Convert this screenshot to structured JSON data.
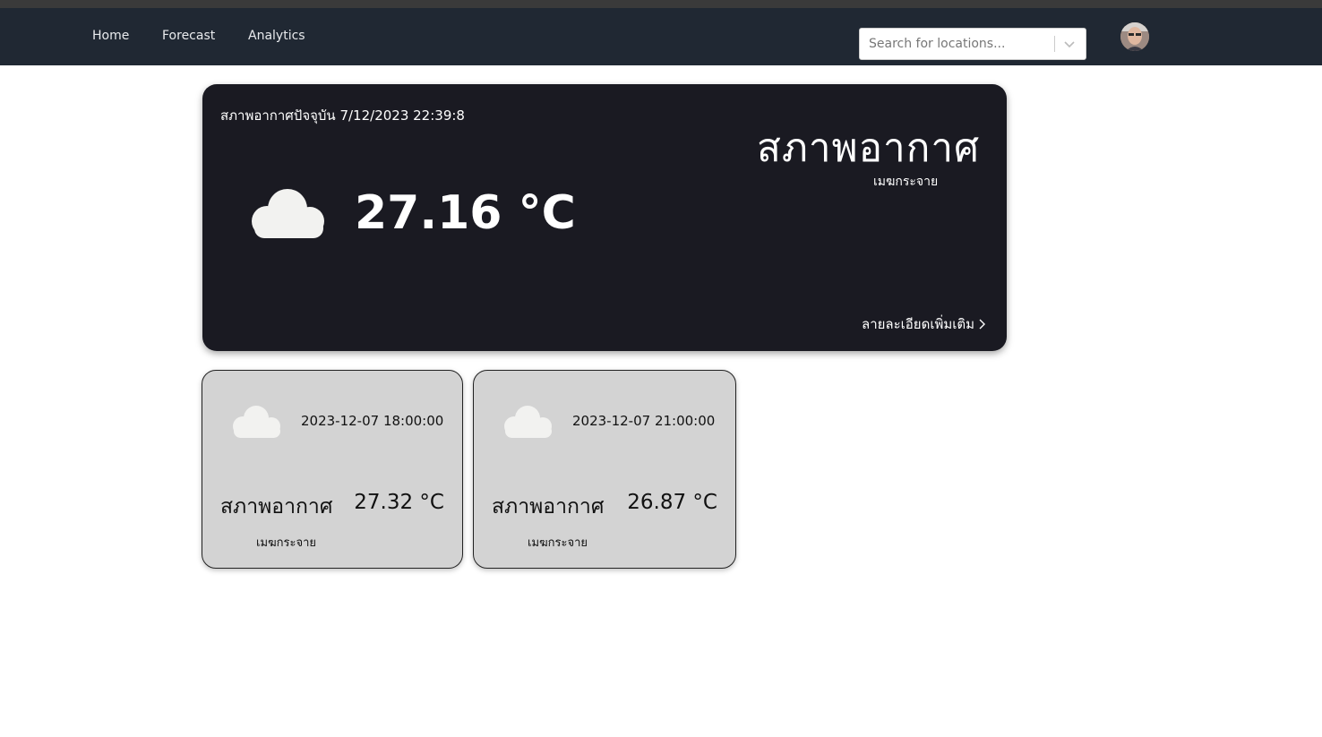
{
  "nav": {
    "links": [
      "Home",
      "Forecast",
      "Analytics"
    ],
    "search": {
      "placeholder": "Search for locations...",
      "value": ""
    },
    "search_icon": "chevron-down-icon",
    "avatar_icon": "user-avatar"
  },
  "current": {
    "datetime_label": "สภาพอากาศปัจจุบัน 7/12/2023 22:39:8",
    "title": "สภาพอากาศ",
    "description": "เมฆกระจาย",
    "temperature": "27.16 °C",
    "more_link": "ลายละเอียดเพิ่มเติม",
    "icon": "cloud-icon"
  },
  "forecast": [
    {
      "time": "2023-12-07 18:00:00",
      "title": "สภาพอากาศ",
      "temperature": "27.32 °C",
      "description": "เมฆกระจาย",
      "icon": "cloud-icon"
    },
    {
      "time": "2023-12-07 21:00:00",
      "title": "สภาพอากาศ",
      "temperature": "26.87 °C",
      "description": "เมฆกระจาย",
      "icon": "cloud-icon"
    }
  ],
  "colors": {
    "navbar": "#202833",
    "main_card": "#1a1a22",
    "forecast_card": "#d3d3d3",
    "cloud": "#f2f2f0"
  }
}
